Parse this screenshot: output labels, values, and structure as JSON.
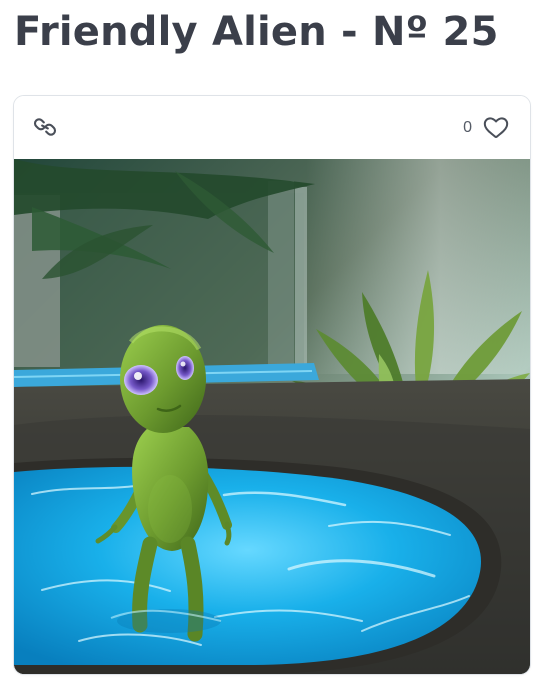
{
  "title": "Friendly Alien - Nº 25",
  "card": {
    "link_icon": "link-icon",
    "like_icon": "heart-outline-icon",
    "like_count": "0"
  },
  "artwork": {
    "subject": "alien-in-pool"
  },
  "colors": {
    "title": "#3b3f4a",
    "border": "#dfe3e8",
    "icon": "#4a4f59",
    "water": "#1ab3e8",
    "alien_green": "#6d9b2f"
  }
}
